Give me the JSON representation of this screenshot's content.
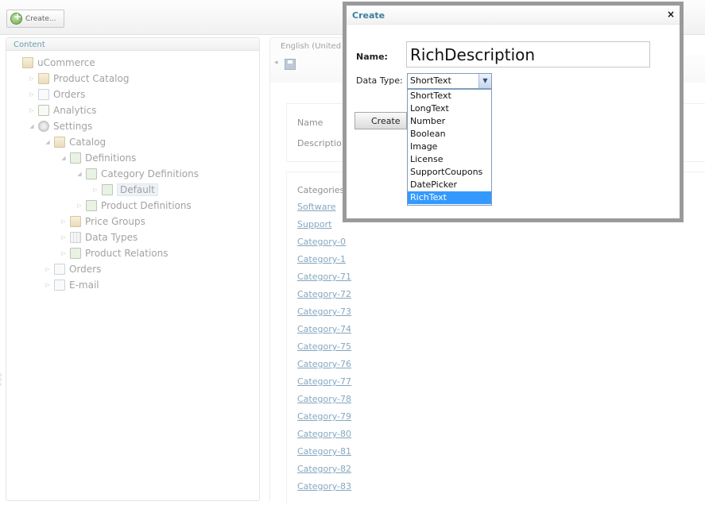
{
  "toolbar": {
    "create_label": "Create..."
  },
  "tree": {
    "header": "Content",
    "nodes": [
      {
        "label": "uCommerce",
        "depth": 0,
        "icon": "folder-icon",
        "name": "tree-node-ucommerce"
      },
      {
        "label": "Product Catalog",
        "depth": 1,
        "icon": "folder-icon",
        "name": "tree-node-product-catalog"
      },
      {
        "label": "Orders",
        "depth": 1,
        "icon": "page-icon",
        "name": "tree-node-orders"
      },
      {
        "label": "Analytics",
        "depth": 1,
        "icon": "chart-icon",
        "name": "tree-node-analytics"
      },
      {
        "label": "Settings",
        "depth": 1,
        "icon": "gear-icon",
        "name": "tree-node-settings"
      },
      {
        "label": "Catalog",
        "depth": 2,
        "icon": "folder-icon",
        "name": "tree-node-catalog"
      },
      {
        "label": "Definitions",
        "depth": 3,
        "icon": "definition-icon",
        "name": "tree-node-definitions"
      },
      {
        "label": "Category Definitions",
        "depth": 4,
        "icon": "definition-icon",
        "name": "tree-node-category-definitions"
      },
      {
        "label": "Default",
        "depth": 5,
        "icon": "definition-icon",
        "name": "tree-node-default"
      },
      {
        "label": "Product Definitions",
        "depth": 4,
        "icon": "definition-icon",
        "name": "tree-node-product-definitions"
      },
      {
        "label": "Price Groups",
        "depth": 3,
        "icon": "folder-icon",
        "name": "tree-node-price-groups"
      },
      {
        "label": "Data Types",
        "depth": 3,
        "icon": "grid-icon",
        "name": "tree-node-data-types"
      },
      {
        "label": "Product Relations",
        "depth": 3,
        "icon": "definition-icon",
        "name": "tree-node-product-relations"
      },
      {
        "label": "Orders",
        "depth": 2,
        "icon": "page-icon",
        "name": "tree-node-settings-orders"
      },
      {
        "label": "E-mail",
        "depth": 2,
        "icon": "page-icon",
        "name": "tree-node-email"
      }
    ]
  },
  "editor": {
    "language_tab": "English (United",
    "name_label": "Name",
    "description_label": "Descriptio",
    "categories_label": "Categories",
    "categories": [
      "Software",
      "Support",
      "Category-0",
      "Category-1",
      "Category-71",
      "Category-72",
      "Category-73",
      "Category-74",
      "Category-75",
      "Category-76",
      "Category-77",
      "Category-78",
      "Category-79",
      "Category-80",
      "Category-81",
      "Category-82",
      "Category-83"
    ]
  },
  "dialog": {
    "title": "Create",
    "close": "×",
    "name_label": "Name:",
    "name_value": "RichDescription",
    "data_type_label": "Data Type:",
    "data_type_selected": "ShortText",
    "create_button": "Create",
    "options": [
      "ShortText",
      "LongText",
      "Number",
      "Boolean",
      "Image",
      "License",
      "SupportCoupons",
      "DatePicker",
      "RichText"
    ],
    "highlighted_option": "RichText"
  }
}
